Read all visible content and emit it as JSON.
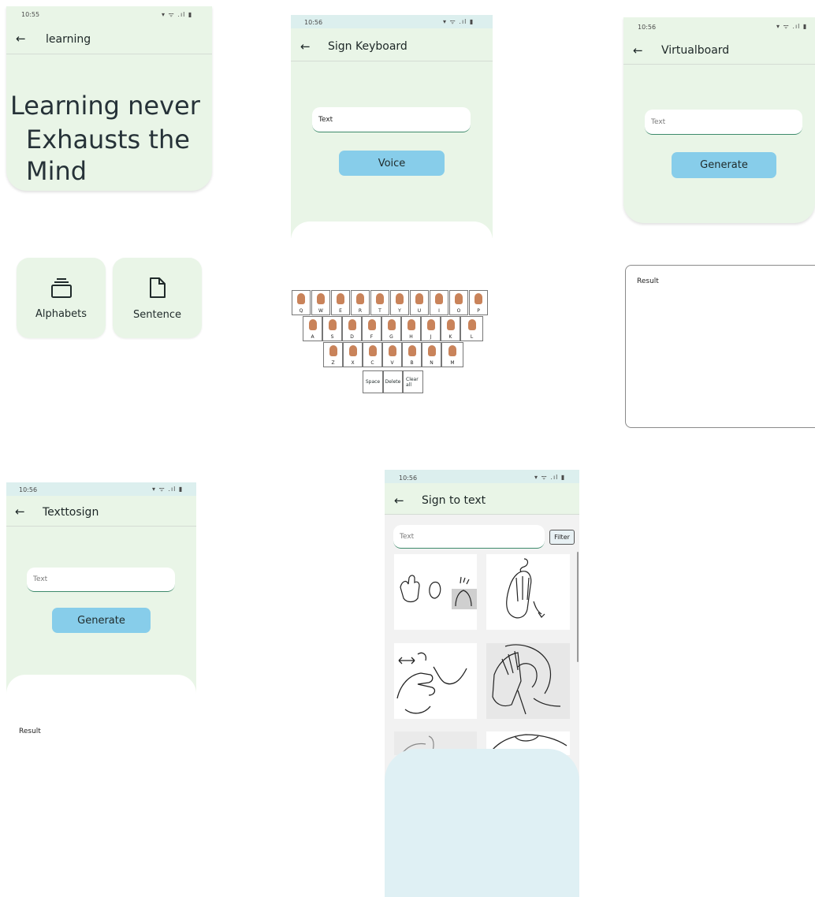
{
  "screens": {
    "learning": {
      "time": "10:55",
      "status_icons": "▾ ᯤ .ıl ▮",
      "title": "learning",
      "hero_line1": "Learning never",
      "hero_line2": "Exhausts the",
      "hero_line3": "Mind",
      "cards": [
        {
          "label": "Alphabets",
          "icon": "stack-icon"
        },
        {
          "label": "Sentence",
          "icon": "document-icon"
        }
      ]
    },
    "sign_keyboard": {
      "time": "10:56",
      "status_icons": "▾ ᯤ .ıl ▮",
      "title": "Sign Keyboard",
      "input_value": "Text",
      "voice_button": "Voice",
      "rows": [
        [
          "Q",
          "W",
          "E",
          "R",
          "T",
          "Y",
          "U",
          "I",
          "O",
          "P"
        ],
        [
          "A",
          "S",
          "D",
          "F",
          "G",
          "H",
          "J",
          "K",
          "L"
        ],
        [
          "Z",
          "X",
          "C",
          "V",
          "B",
          "N",
          "M"
        ]
      ],
      "space_label": "Space",
      "delete_label": "Delete",
      "clear_label_1": "Clear",
      "clear_label_2": "all"
    },
    "virtualboard": {
      "time": "10:56",
      "status_icons": "▾ ᯤ .ıl ▮",
      "title": "Virtualboard",
      "input_placeholder": "Text",
      "generate_button": "Generate",
      "result_label": "Result"
    },
    "texttosign": {
      "time": "10:56",
      "status_icons": "▾ ᯤ .ıl ▮",
      "title": "Texttosign",
      "input_placeholder": "Text",
      "generate_button": "Generate",
      "result_label": "Result"
    },
    "sign_to_text": {
      "time": "10:56",
      "status_icons": "▾ ᯤ .ıl ▮",
      "title": "Sign to text",
      "input_placeholder": "Text",
      "filter_button": "Filter"
    }
  },
  "colors": {
    "header_green": "#e9f5e7",
    "button_blue": "#87cdea",
    "panel_blue": "#dff0f4"
  }
}
